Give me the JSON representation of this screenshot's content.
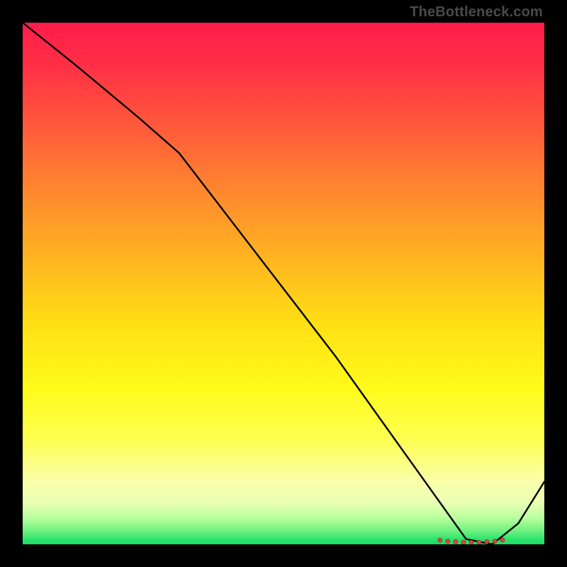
{
  "attribution": "TheBottleneck.com",
  "colors": {
    "curve": "#000000",
    "dot_fill": "#d34a3a",
    "dot_stroke": "#9c2f23"
  },
  "chart_data": {
    "type": "line",
    "title": "",
    "xlabel": "",
    "ylabel": "",
    "xlim": [
      0,
      100
    ],
    "ylim": [
      0,
      100
    ],
    "grid": false,
    "legend": false,
    "series": [
      {
        "name": "curve",
        "x": [
          0,
          10,
          22,
          30,
          40,
          50,
          60,
          70,
          80,
          85,
          90,
          95,
          100
        ],
        "values": [
          100,
          92,
          82,
          75,
          62,
          49,
          36,
          22,
          8,
          1,
          0,
          4,
          12
        ]
      }
    ],
    "markers": {
      "x": [
        80,
        81.5,
        83,
        84.5,
        86,
        87.5,
        89,
        90.5,
        92
      ],
      "values": [
        0.8,
        0.6,
        0.5,
        0.4,
        0.4,
        0.4,
        0.5,
        0.6,
        0.8
      ],
      "label": ""
    }
  }
}
